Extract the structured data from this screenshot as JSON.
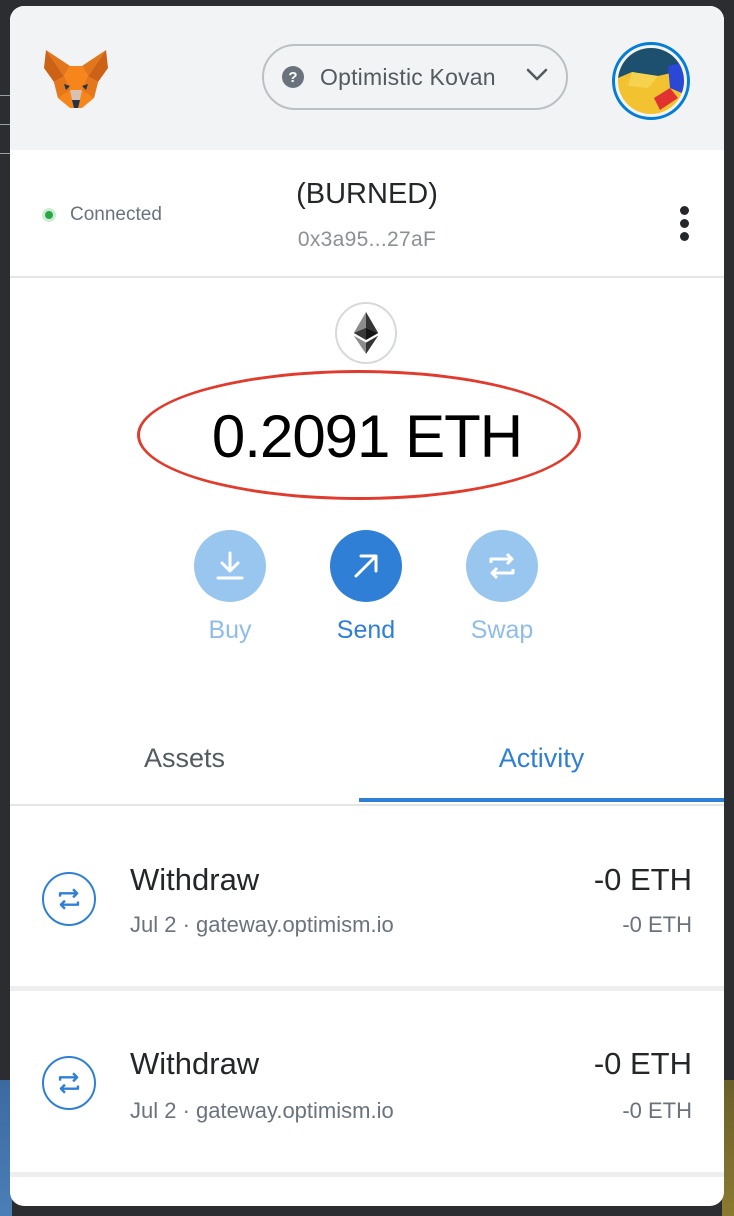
{
  "network": {
    "name": "Optimistic Kovan"
  },
  "account": {
    "status": "Connected",
    "name": "(BURNED)",
    "address": "0x3a95...27aF"
  },
  "balance": {
    "display": "0.2091 ETH"
  },
  "actions": [
    {
      "label": "Buy"
    },
    {
      "label": "Send"
    },
    {
      "label": "Swap"
    }
  ],
  "tabs": [
    {
      "label": "Assets",
      "active": false
    },
    {
      "label": "Activity",
      "active": true
    }
  ],
  "transactions": [
    {
      "title": "Withdraw",
      "subtitle": "Jul 2 · gateway.optimism.io",
      "amount": "-0 ETH",
      "secondary_amount": "-0 ETH"
    },
    {
      "title": "Withdraw",
      "subtitle": "Jul 2 · gateway.optimism.io",
      "amount": "-0 ETH",
      "secondary_amount": "-0 ETH"
    }
  ],
  "colors": {
    "accent": "#2f7fd6",
    "accent_light": "#99c6ef",
    "highlight_ring": "#e03b2c",
    "connected": "#28a745"
  }
}
